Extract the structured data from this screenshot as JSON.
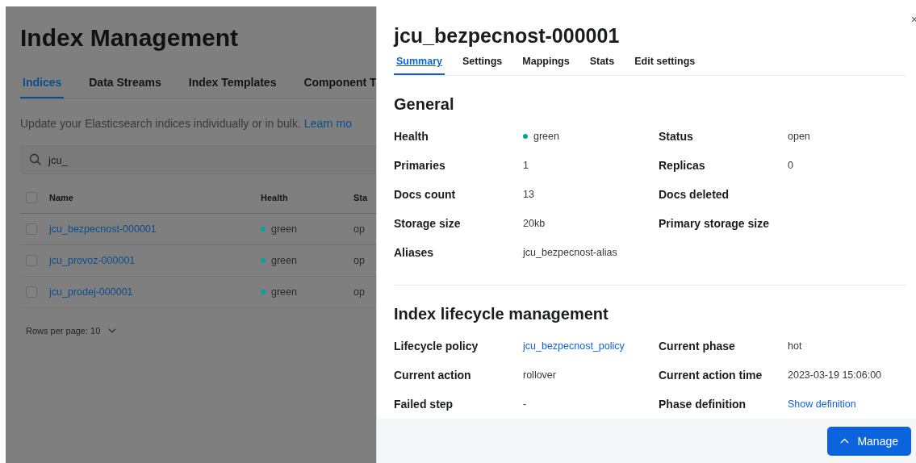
{
  "page": {
    "title": "Index Management",
    "tabs": [
      {
        "label": "Indices",
        "selected": true
      },
      {
        "label": "Data Streams",
        "selected": false
      },
      {
        "label": "Index Templates",
        "selected": false
      },
      {
        "label": "Component T",
        "selected": false
      }
    ],
    "description": "Update your Elasticsearch indices individually or in bulk.",
    "learn_more_link": "Learn mo",
    "search": {
      "value": "jcu_"
    },
    "table": {
      "columns": [
        "Name",
        "Health",
        "Sta"
      ],
      "select_all_checked": false,
      "rows": [
        {
          "name": "jcu_bezpecnost-000001",
          "health": "green",
          "color": "#00a69b",
          "status": "op",
          "checked": false
        },
        {
          "name": "jcu_provoz-000001",
          "health": "green",
          "color": "#00a69b",
          "status": "op",
          "checked": false
        },
        {
          "name": "jcu_prodej-000001",
          "health": "green",
          "color": "#00a69b",
          "status": "op",
          "checked": false
        }
      ]
    },
    "rows_per_page": "Rows per page: 10"
  },
  "flyout": {
    "title": "jcu_bezpecnost-000001",
    "close": "×",
    "tabs": [
      {
        "label": "Summary",
        "selected": true
      },
      {
        "label": "Settings",
        "selected": false
      },
      {
        "label": "Mappings",
        "selected": false
      },
      {
        "label": "Stats",
        "selected": false
      },
      {
        "label": "Edit settings",
        "selected": false
      }
    ],
    "sections": [
      {
        "heading": "General",
        "fields": [
          {
            "label": "Health",
            "value": "green",
            "kind": "status",
            "color": "#00a69b"
          },
          {
            "label": "Status",
            "value": "open",
            "kind": "text"
          },
          {
            "label": "Primaries",
            "value": "1",
            "kind": "text"
          },
          {
            "label": "Replicas",
            "value": "0",
            "kind": "text"
          },
          {
            "label": "Docs count",
            "value": "13",
            "kind": "text"
          },
          {
            "label": "Docs deleted"
          },
          {
            "label": "Storage size",
            "value": "20kb",
            "kind": "text"
          },
          {
            "label": "Primary storage size"
          },
          {
            "label": "Aliases",
            "value": "jcu_bezpecnost-alias",
            "kind": "text"
          }
        ]
      },
      {
        "heading": "Index lifecycle management",
        "fields": [
          {
            "label": "Lifecycle policy",
            "value": "jcu_bezpecnost_policy",
            "kind": "link"
          },
          {
            "label": "Current phase",
            "value": "hot",
            "kind": "text"
          },
          {
            "label": "Current action",
            "value": "rollover",
            "kind": "text"
          },
          {
            "label": "Current action time",
            "value": "2023-03-19 15:06:00",
            "kind": "text"
          },
          {
            "label": "Failed step",
            "value": "-",
            "kind": "text"
          },
          {
            "label": "Phase definition",
            "value": "Show definition",
            "kind": "link"
          }
        ]
      }
    ],
    "manage_button": "Manage"
  }
}
